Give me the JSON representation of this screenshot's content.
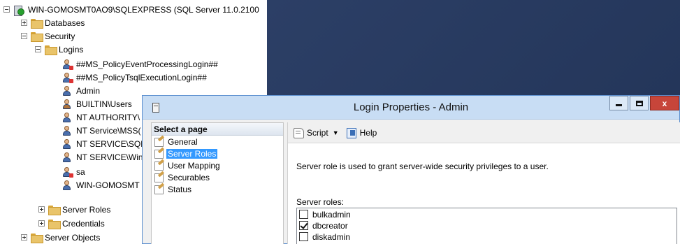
{
  "tree": {
    "server": "WIN-GOMOSMT0AO9\\SQLEXPRESS (SQL Server 11.0.2100",
    "databases": "Databases",
    "security": "Security",
    "logins": "Logins",
    "login_items": [
      "##MS_PolicyEventProcessingLogin##",
      "##MS_PolicyTsqlExecutionLogin##",
      "Admin",
      "BUILTIN\\Users",
      "NT AUTHORITY\\",
      "NT Service\\MSS(",
      "NT SERVICE\\SQL",
      "NT SERVICE\\Win",
      "sa",
      "WIN-GOMOSMT"
    ],
    "server_roles": "Server Roles",
    "credentials": "Credentials",
    "server_objects": "Server Objects"
  },
  "dialog": {
    "title": "Login Properties - Admin",
    "close_glyph": "x",
    "select_page": "Select a page",
    "pages": [
      "General",
      "Server Roles",
      "User Mapping",
      "Securables",
      "Status"
    ],
    "selected_page": "Server Roles",
    "toolbar": {
      "script_label": "Script",
      "script_caret": "▼",
      "help_label": "Help"
    },
    "description": "Server role is used to grant server-wide security privileges to a user.",
    "roles_label": "Server roles:",
    "roles": [
      {
        "name": "bulkadmin",
        "checked": false
      },
      {
        "name": "dbcreator",
        "checked": true
      },
      {
        "name": "diskadmin",
        "checked": false
      }
    ]
  }
}
